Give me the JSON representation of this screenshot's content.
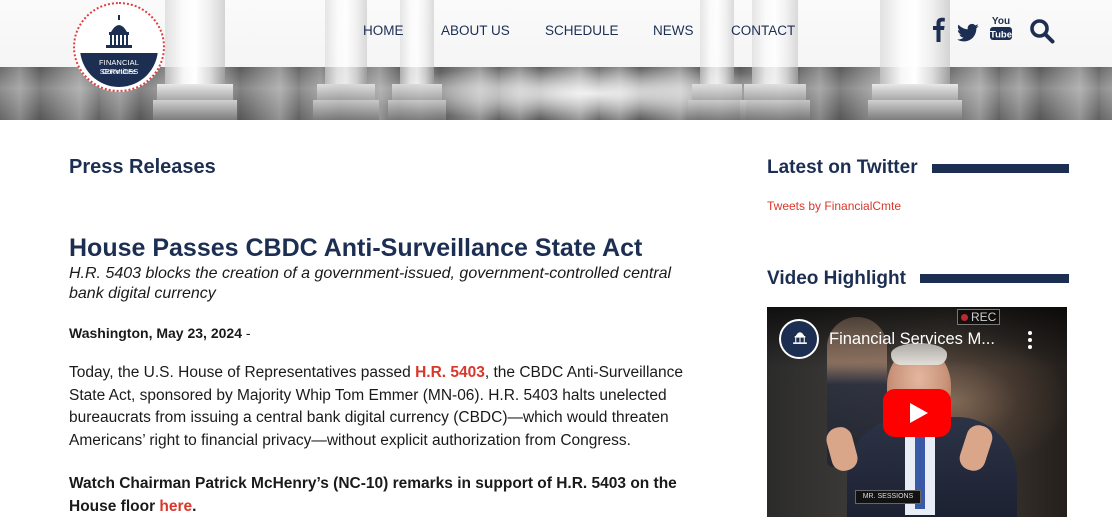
{
  "logo": {
    "line1": "FINANCIAL SERVICES",
    "line2": "Committee"
  },
  "nav": {
    "items": [
      "HOME",
      "ABOUT US",
      "SCHEDULE",
      "NEWS",
      "CONTACT"
    ]
  },
  "social": {
    "icons": [
      "facebook-icon",
      "twitter-icon",
      "youtube-icon",
      "search-icon"
    ],
    "youtube_text": "You Tube"
  },
  "main": {
    "section_title": "Press Releases",
    "headline": "House Passes CBDC Anti-Surveillance State Act",
    "subhead": "H.R. 5403 blocks the creation of a government-issued, government-controlled central bank digital currency",
    "dateline": {
      "place_date": "Washington, May 23, 2024",
      "separator": " -"
    },
    "paragraph1": {
      "before": "Today, the U.S. House of Representatives passed ",
      "link": "H.R. 5403",
      "after": ", the CBDC Anti-Surveillance State Act, sponsored by Majority Whip Tom Emmer (MN-06). H.R. 5403 halts unelected bureaucrats from issuing a central bank digital currency (CBDC)—which would threaten Americans’ right to financial privacy—without explicit authorization from Congress."
    },
    "paragraph2": {
      "before": "Watch Chairman Patrick McHenry’s (NC-10) remarks in support of H.R. 5403 on the House floor ",
      "link": "here",
      "after": "."
    }
  },
  "sidebar": {
    "twitter_title": "Latest on Twitter",
    "tweets_link": "Tweets by FinancialCmte",
    "video_title": "Video Highlight",
    "video": {
      "channel_title": "Financial Services M...",
      "rec_label": "REC",
      "nameplate": "MR. SESSIONS"
    }
  },
  "colors": {
    "navy": "#1c2f52",
    "link_red": "#d9372b",
    "youtube_red": "#ff0000"
  }
}
